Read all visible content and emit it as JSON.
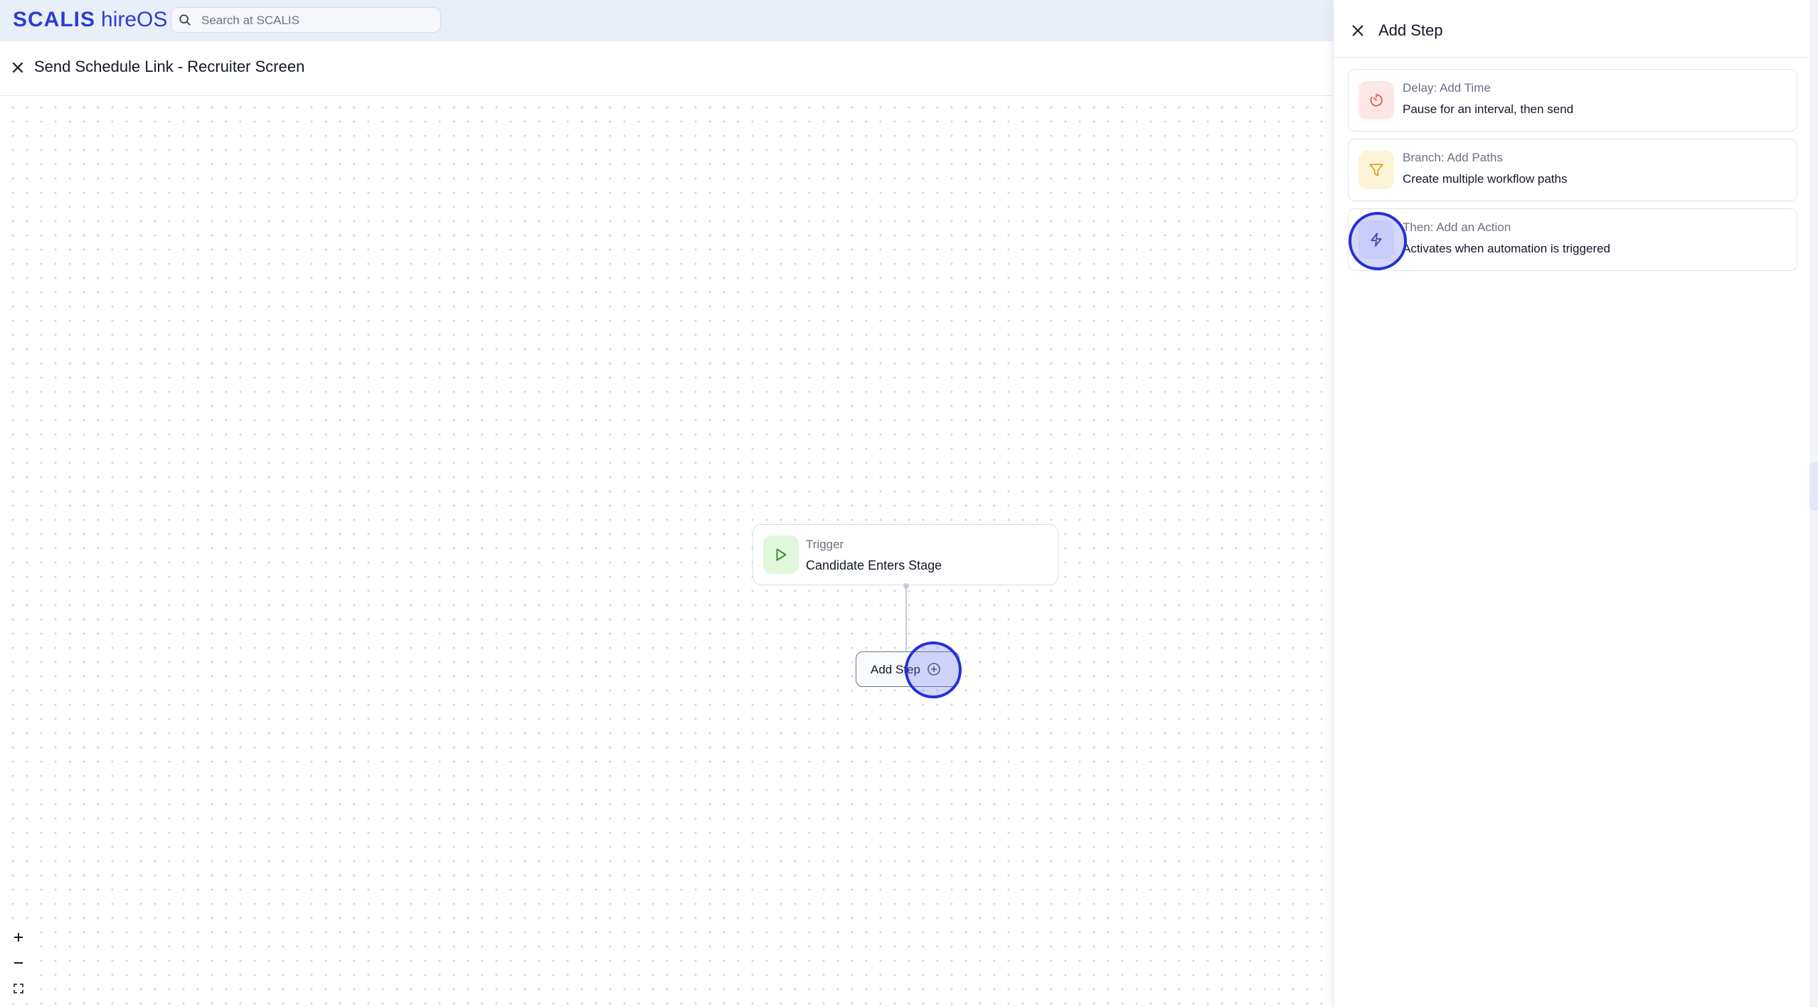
{
  "app": {
    "brand": "SCALIS",
    "product": "hireOS",
    "search": {
      "placeholder": "Search at SCALIS"
    }
  },
  "header": {
    "title": "Send Schedule Link - Recruiter Screen"
  },
  "canvas": {
    "trigger": {
      "label": "Trigger",
      "value": "Candidate Enters Stage",
      "icon": "play-icon"
    },
    "add_step": {
      "label": "Add Step",
      "icon": "plus-circle-icon"
    }
  },
  "panel": {
    "title": "Add Step",
    "options": [
      {
        "label": "Delay: Add Time",
        "description": "Pause for an interval, then send",
        "icon": "timer-icon",
        "color": "#f29b95",
        "bg": "#fde7e6"
      },
      {
        "label": "Branch: Add Paths",
        "description": "Create multiple workflow paths",
        "icon": "filter-icon",
        "color": "#d9a11c",
        "bg": "#fdf3d6"
      },
      {
        "label": "Then: Add an Action",
        "description": "Activates when automation is triggered",
        "icon": "lightning-icon",
        "color": "#2e3a8c",
        "bg": "#eef1fb"
      }
    ]
  },
  "colors": {
    "brand": "#2a3dd6",
    "trigger_icon_bg": "#e1f7dc",
    "trigger_icon": "#3b8f2e",
    "click_ring": "#2430d8"
  }
}
